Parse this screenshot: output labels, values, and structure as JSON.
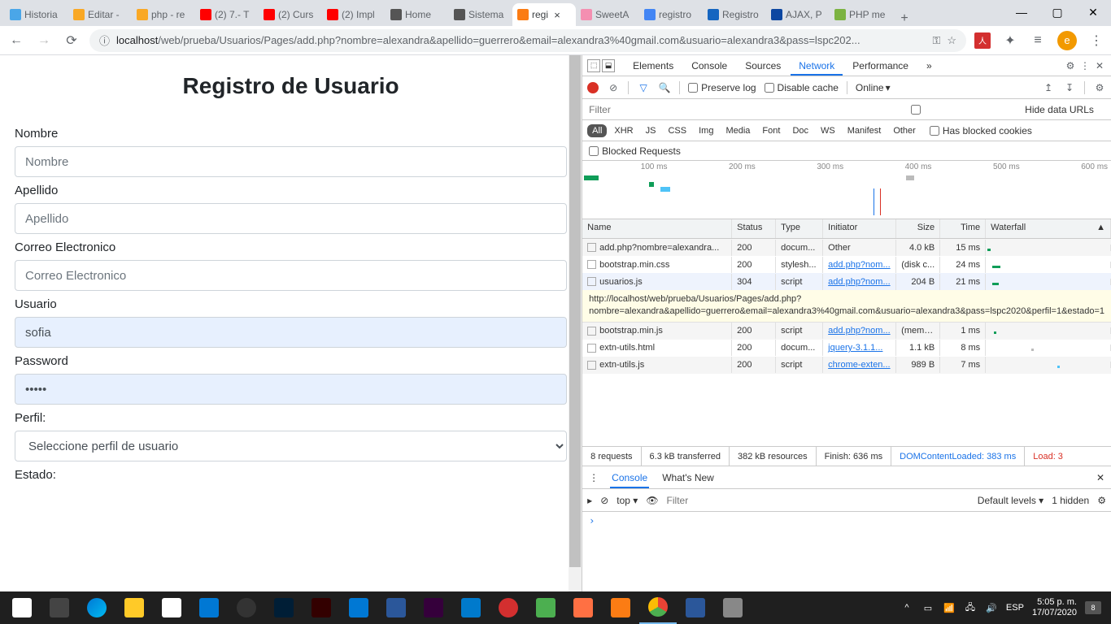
{
  "tabs": [
    {
      "label": "Historia",
      "color": "#4aa6e8"
    },
    {
      "label": "Editar -",
      "color": "#f9a825"
    },
    {
      "label": "php - re",
      "color": "#f9a825"
    },
    {
      "label": "(2) 7.- T",
      "color": "#ff0000"
    },
    {
      "label": "(2) Curs",
      "color": "#ff0000"
    },
    {
      "label": "(2) Impl",
      "color": "#ff0000"
    },
    {
      "label": "Home",
      "color": "#555"
    },
    {
      "label": "Sistema",
      "color": "#555"
    },
    {
      "label": "regi",
      "color": "#fb7c14",
      "active": true
    },
    {
      "label": "SweetA",
      "color": "#f48fb1"
    },
    {
      "label": "registro",
      "color": "#4285f4"
    },
    {
      "label": "Registro",
      "color": "#1565c0"
    },
    {
      "label": "AJAX, P",
      "color": "#0d47a1"
    },
    {
      "label": "PHP me",
      "color": "#7cb342"
    }
  ],
  "url": {
    "host": "localhost",
    "path": "/web/prueba/Usuarios/Pages/add.php?nombre=alexandra&apellido=guerrero&email=alexandra3%40gmail.com&usuario=alexandra3&pass=lspc202..."
  },
  "profile_letter": "e",
  "form": {
    "title": "Registro de Usuario",
    "nombre_label": "Nombre",
    "nombre_ph": "Nombre",
    "apellido_label": "Apellido",
    "apellido_ph": "Apellido",
    "correo_label": "Correo Electronico",
    "correo_ph": "Correo Electronico",
    "usuario_label": "Usuario",
    "usuario_val": "sofia",
    "password_label": "Password",
    "password_val": "•••••",
    "perfil_label": "Perfil:",
    "perfil_opt": "Seleccione perfil de usuario",
    "estado_label": "Estado:"
  },
  "dt": {
    "tabs": [
      "Elements",
      "Console",
      "Sources",
      "Network",
      "Performance"
    ],
    "active_tab": "Network",
    "preserve": "Preserve log",
    "disable_cache": "Disable cache",
    "online": "Online",
    "filter_ph": "Filter",
    "hide_urls": "Hide data URLs",
    "types": [
      "All",
      "XHR",
      "JS",
      "CSS",
      "Img",
      "Media",
      "Font",
      "Doc",
      "WS",
      "Manifest",
      "Other"
    ],
    "blocked_cookies": "Has blocked cookies",
    "blocked_req": "Blocked Requests",
    "tl": [
      "100 ms",
      "200 ms",
      "300 ms",
      "400 ms",
      "500 ms",
      "600 ms"
    ],
    "cols": {
      "name": "Name",
      "status": "Status",
      "type": "Type",
      "initiator": "Initiator",
      "size": "Size",
      "time": "Time",
      "waterfall": "Waterfall"
    },
    "rows": [
      {
        "name": "add.php?nombre=alexandra...",
        "status": "200",
        "type": "docum...",
        "init": "Other",
        "init_link": false,
        "size": "4.0 kB",
        "time": "15 ms"
      },
      {
        "name": "bootstrap.min.css",
        "status": "200",
        "type": "stylesh...",
        "init": "add.php?nom...",
        "init_link": true,
        "size": "(disk c...",
        "time": "24 ms"
      },
      {
        "name": "usuarios.js",
        "status": "304",
        "type": "script",
        "init": "add.php?nom...",
        "init_link": true,
        "size": "204 B",
        "time": "21 ms",
        "sel": true
      }
    ],
    "tooltip": "http://localhost/web/prueba/Usuarios/Pages/add.php?nombre=alexandra&apellido=guerrero&email=alexandra3%40gmail.com&usuario=alexandra3&pass=lspc2020&perfil=1&estado=1",
    "rows2": [
      {
        "name": "bootstrap.min.js",
        "status": "200",
        "type": "script",
        "init": "add.php?nom...",
        "init_link": true,
        "size": "(memo...",
        "time": "1 ms"
      },
      {
        "name": "extn-utils.html",
        "status": "200",
        "type": "docum...",
        "init": "jquery-3.1.1...",
        "init_link": true,
        "size": "1.1 kB",
        "time": "8 ms"
      },
      {
        "name": "extn-utils.js",
        "status": "200",
        "type": "script",
        "init": "chrome-exten...",
        "init_link": true,
        "size": "989 B",
        "time": "7 ms"
      }
    ],
    "summary": {
      "req": "8 requests",
      "trans": "6.3 kB transferred",
      "res": "382 kB resources",
      "finish": "Finish: 636 ms",
      "dom": "DOMContentLoaded: 383 ms",
      "load": "Load: 3"
    },
    "console_tabs": [
      "Console",
      "What's New"
    ],
    "ctx": "top",
    "levels": "Default levels ▾",
    "hidden": "1 hidden",
    "prompt": "›"
  },
  "taskbar": {
    "lang": "ESP",
    "time": "5:05 p. m.",
    "date": "17/07/2020",
    "badge": "8"
  }
}
